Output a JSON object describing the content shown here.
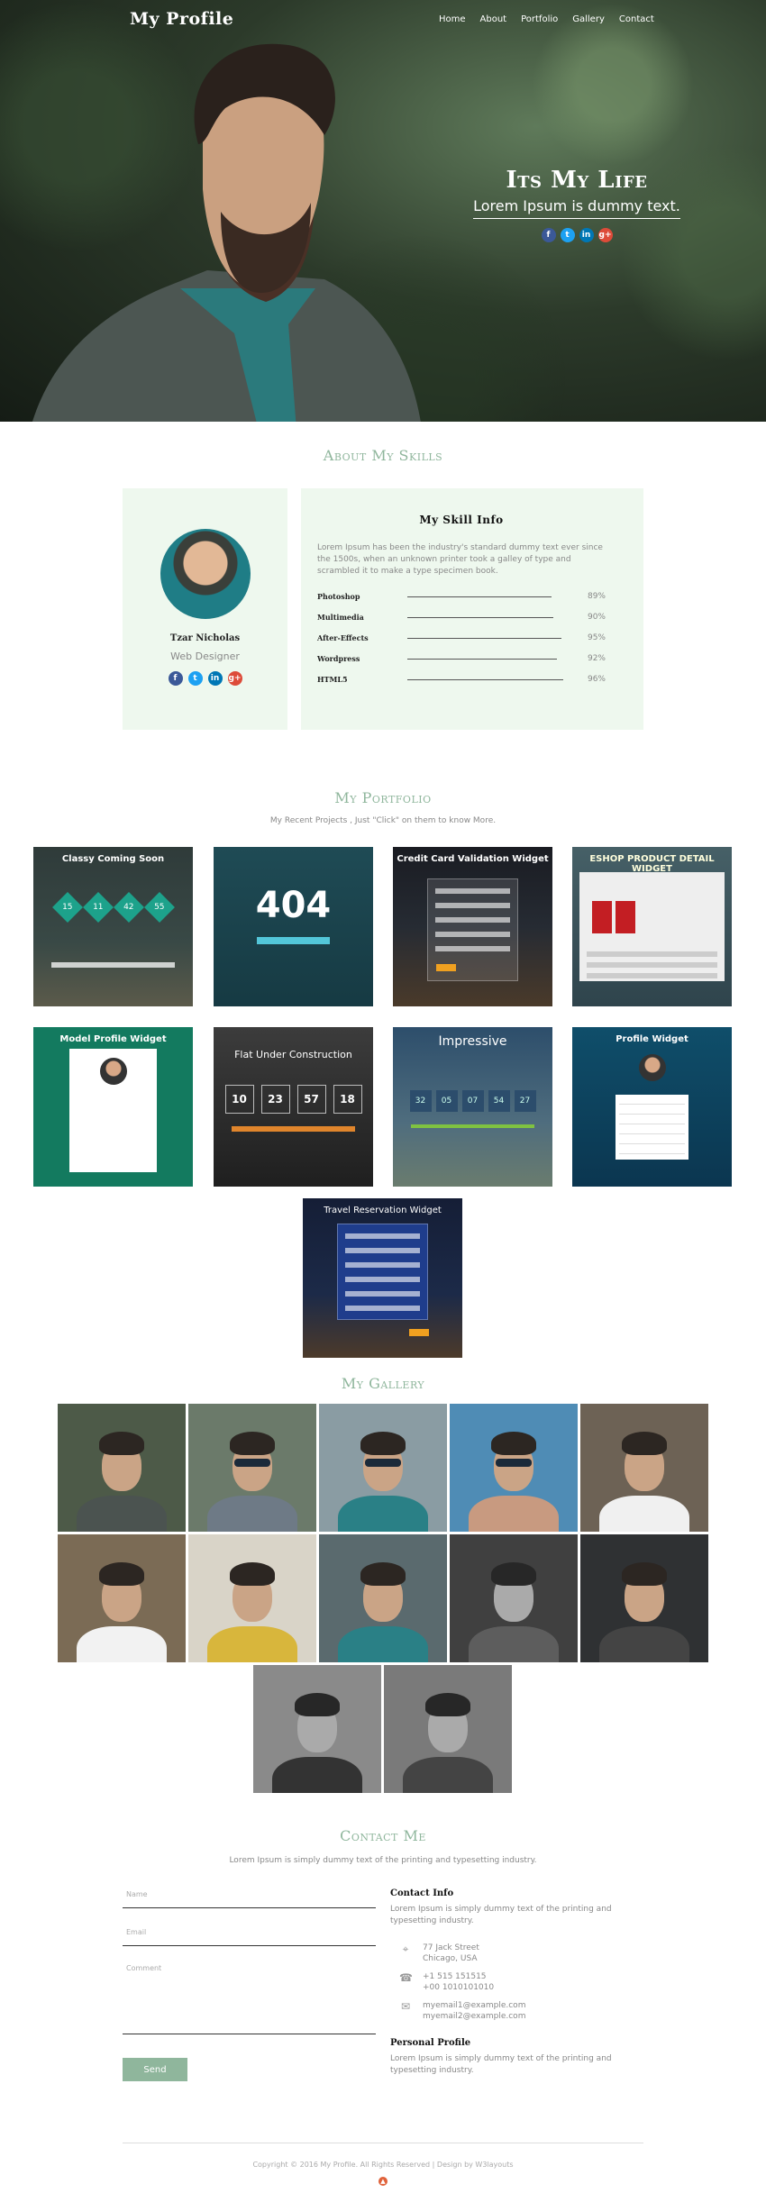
{
  "header": {
    "brand": "My Profile",
    "nav": [
      "Home",
      "About",
      "Portfolio",
      "Gallery",
      "Contact"
    ]
  },
  "hero": {
    "title": "Its My Life",
    "subtitle": "Lorem Ipsum is dummy text.",
    "social_icons": [
      "facebook-icon",
      "twitter-icon",
      "linkedin-icon",
      "google-plus-icon"
    ]
  },
  "skills": {
    "title": "About My Skills",
    "profile": {
      "name": "Tzar Nicholas",
      "role": "Web Designer",
      "social_icons": [
        "facebook-icon",
        "twitter-icon",
        "linkedin-icon",
        "google-plus-icon"
      ]
    },
    "info": {
      "title": "My Skill Info",
      "text": "Lorem Ipsum has been the industry's standard dummy text ever since the 1500s, when an unknown printer took a galley of type and scrambled it to make a type specimen book.",
      "items": [
        {
          "name": "Photoshop",
          "percent": "89%",
          "value": 89
        },
        {
          "name": "Multimedia",
          "percent": "90%",
          "value": 90
        },
        {
          "name": "After-Effects",
          "percent": "95%",
          "value": 95
        },
        {
          "name": "Wordpress",
          "percent": "92%",
          "value": 92
        },
        {
          "name": "HTML5",
          "percent": "96%",
          "value": 96
        }
      ]
    }
  },
  "portfolio": {
    "title": "My Portfolio",
    "subtitle": "My Recent Projects , Just \"Click\" on them to know More.",
    "items": [
      {
        "title": "Classy Coming Soon",
        "counts": [
          "15",
          "11",
          "42",
          "55"
        ]
      },
      {
        "title": "",
        "big": "404"
      },
      {
        "title": "Credit Card Validation Widget"
      },
      {
        "title": "ESHOP PRODUCT DETAIL WIDGET"
      },
      {
        "title": "Model Profile Widget"
      },
      {
        "title": "Flat Under Construction",
        "counts": [
          "10",
          "23",
          "57",
          "18"
        ]
      },
      {
        "title": "Impressive",
        "counts": [
          "32",
          "05",
          "07",
          "54",
          "27"
        ]
      },
      {
        "title": "Profile Widget"
      },
      {
        "title": "Travel Reservation Widget"
      }
    ]
  },
  "gallery": {
    "title": "My Gallery"
  },
  "contact": {
    "title": "Contact Me",
    "subtitle": "Lorem Ipsum is simply dummy text of the printing and typesetting industry.",
    "form": {
      "name_placeholder": "Name",
      "email_placeholder": "Email",
      "comment_placeholder": "Comment",
      "send_label": "Send"
    },
    "info": {
      "title": "Contact Info",
      "text": "Lorem Ipsum is simply dummy text of the printing and typesetting industry.",
      "address": [
        "77 Jack Street",
        "Chicago, USA"
      ],
      "phones": [
        "+1 515 151515",
        "+00 1010101010"
      ],
      "emails": [
        "myemail1@example.com",
        "myemail2@example.com"
      ]
    },
    "personal": {
      "title": "Personal Profile",
      "text": "Lorem Ipsum is simply dummy text of the printing and typesetting industry."
    }
  },
  "footer": {
    "copyright": "Copyright © 2016 My Profile. All Rights Reserved | Design by W3layouts"
  }
}
